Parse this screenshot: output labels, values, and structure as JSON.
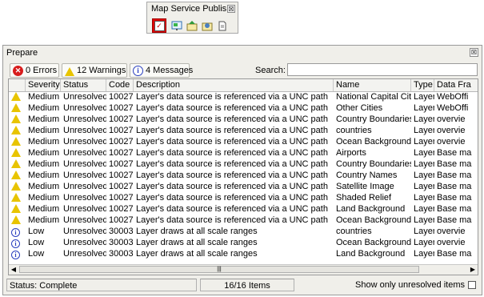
{
  "toolbar": {
    "title": "Map Service Publis...",
    "close_glyph": "☒",
    "buttons": [
      {
        "icon": "analyze-check-icon",
        "active": true
      },
      {
        "icon": "preview-map-icon"
      },
      {
        "icon": "publish-icon"
      },
      {
        "icon": "settings-icon"
      },
      {
        "icon": "document-icon"
      }
    ]
  },
  "window": {
    "title": "Prepare",
    "close_glyph": "☒"
  },
  "filters": {
    "errors": "0 Errors",
    "warnings": "12 Warnings",
    "messages": "4 Messages",
    "search_label": "Search:",
    "search_value": ""
  },
  "columns": [
    "Severity",
    "Status",
    "Code",
    "Description",
    "Name",
    "Type",
    "Data Fra"
  ],
  "rows": [
    {
      "icon": "warning",
      "severity": "Medium",
      "status": "Unresolved",
      "code": "10027",
      "description": "Layer's data source is referenced via a UNC path",
      "name": "National Capital Cities",
      "type": "Layer",
      "frame": "WebOffi"
    },
    {
      "icon": "warning",
      "severity": "Medium",
      "status": "Unresolved",
      "code": "10027",
      "description": "Layer's data source is referenced via a UNC path",
      "name": "Other Cities",
      "type": "Layer",
      "frame": "WebOffi"
    },
    {
      "icon": "warning",
      "severity": "Medium",
      "status": "Unresolved",
      "code": "10027",
      "description": "Layer's data source is referenced via a UNC path",
      "name": "Country Boundaries",
      "type": "Layer",
      "frame": "overvie"
    },
    {
      "icon": "warning",
      "severity": "Medium",
      "status": "Unresolved",
      "code": "10027",
      "description": "Layer's data source is referenced via a UNC path",
      "name": "countries",
      "type": "Layer",
      "frame": "overvie"
    },
    {
      "icon": "warning",
      "severity": "Medium",
      "status": "Unresolved",
      "code": "10027",
      "description": "Layer's data source is referenced via a UNC path",
      "name": "Ocean Background",
      "type": "Layer",
      "frame": "overvie"
    },
    {
      "icon": "warning",
      "severity": "Medium",
      "status": "Unresolved",
      "code": "10027",
      "description": "Layer's data source is referenced via a UNC path",
      "name": "Airports",
      "type": "Layer",
      "frame": "Base ma"
    },
    {
      "icon": "warning",
      "severity": "Medium",
      "status": "Unresolved",
      "code": "10027",
      "description": "Layer's data source is referenced via a UNC path",
      "name": "Country Boundaries",
      "type": "Layer",
      "frame": "Base ma"
    },
    {
      "icon": "warning",
      "severity": "Medium",
      "status": "Unresolved",
      "code": "10027",
      "description": "Layer's data source is referenced via a UNC path",
      "name": "Country Names",
      "type": "Layer",
      "frame": "Base ma"
    },
    {
      "icon": "warning",
      "severity": "Medium",
      "status": "Unresolved",
      "code": "10027",
      "description": "Layer's data source is referenced via a UNC path",
      "name": "Satellite Image",
      "type": "Layer",
      "frame": "Base ma"
    },
    {
      "icon": "warning",
      "severity": "Medium",
      "status": "Unresolved",
      "code": "10027",
      "description": "Layer's data source is referenced via a UNC path",
      "name": "Shaded Relief",
      "type": "Layer",
      "frame": "Base ma"
    },
    {
      "icon": "warning",
      "severity": "Medium",
      "status": "Unresolved",
      "code": "10027",
      "description": "Layer's data source is referenced via a UNC path",
      "name": "Land Background",
      "type": "Layer",
      "frame": "Base ma"
    },
    {
      "icon": "warning",
      "severity": "Medium",
      "status": "Unresolved",
      "code": "10027",
      "description": "Layer's data source is referenced via a UNC path",
      "name": "Ocean Background",
      "type": "Layer",
      "frame": "Base ma"
    },
    {
      "icon": "info",
      "severity": "Low",
      "status": "Unresolved",
      "code": "30003",
      "description": "Layer draws at all scale ranges",
      "name": "countries",
      "type": "Layer",
      "frame": "overvie"
    },
    {
      "icon": "info",
      "severity": "Low",
      "status": "Unresolved",
      "code": "30003",
      "description": "Layer draws at all scale ranges",
      "name": "Ocean Background",
      "type": "Layer",
      "frame": "overvie"
    },
    {
      "icon": "info",
      "severity": "Low",
      "status": "Unresolved",
      "code": "30003",
      "description": "Layer draws at all scale ranges",
      "name": "Land Background",
      "type": "Layer",
      "frame": "Base ma"
    }
  ],
  "status_bar": {
    "status": "Status: Complete",
    "items": "16/16 Items",
    "toggle_label": "Show only unresolved items",
    "toggle_checked": false
  },
  "colors": {
    "active_tool": "#e00000",
    "warning": "#e8c400",
    "error": "#d81c1c",
    "info": "#2a3fbf"
  }
}
